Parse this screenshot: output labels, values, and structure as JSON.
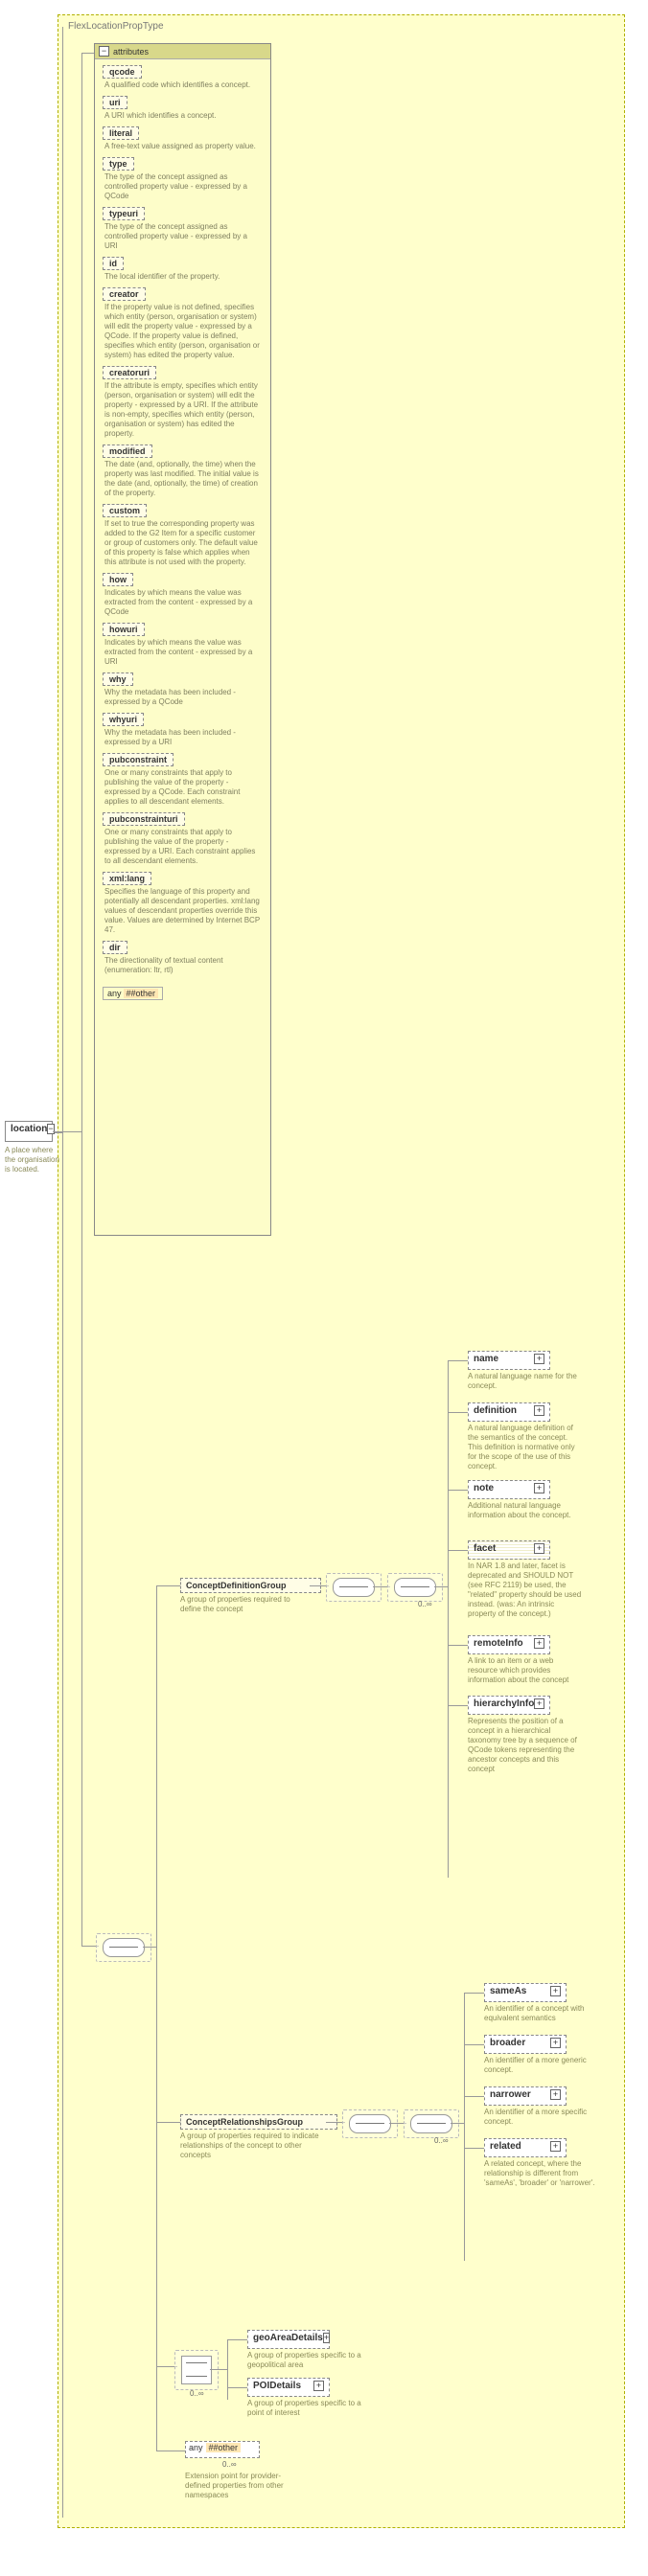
{
  "root": {
    "title": "FlexLocationPropType"
  },
  "attribs_header": "attributes",
  "attrs": [
    {
      "n": "qcode",
      "d": "A qualified code which identifies a concept."
    },
    {
      "n": "uri",
      "d": "A URI which identifies a concept."
    },
    {
      "n": "literal",
      "d": "A free-text value assigned as property value."
    },
    {
      "n": "type",
      "d": "The type of the concept assigned as controlled property value - expressed by a QCode"
    },
    {
      "n": "typeuri",
      "d": "The type of the concept assigned as controlled property value - expressed by a URI"
    },
    {
      "n": "id",
      "d": "The local identifier of the property."
    },
    {
      "n": "creator",
      "d": "If the property value is not defined, specifies which entity (person, organisation or system) will edit the property value - expressed by a QCode. If the property value is defined, specifies which entity (person, organisation or system) has edited the property value."
    },
    {
      "n": "creatoruri",
      "d": "If the attribute is empty, specifies which entity (person, organisation or system) will edit the property - expressed by a URI. If the attribute is non-empty, specifies which entity (person, organisation or system) has edited the property."
    },
    {
      "n": "modified",
      "d": "The date (and, optionally, the time) when the property was last modified. The initial value is the date (and, optionally, the time) of creation of the property."
    },
    {
      "n": "custom",
      "d": "If set to true the corresponding property was added to the G2 Item for a specific customer or group of customers only. The default value of this property is false which applies when this attribute is not used with the property."
    },
    {
      "n": "how",
      "d": "Indicates by which means the value was extracted from the content - expressed by a QCode"
    },
    {
      "n": "howuri",
      "d": "Indicates by which means the value was extracted from the content - expressed by a URI"
    },
    {
      "n": "why",
      "d": "Why the metadata has been included - expressed by a QCode"
    },
    {
      "n": "whyuri",
      "d": "Why the metadata has been included - expressed by a URI"
    },
    {
      "n": "pubconstraint",
      "d": "One or many constraints that apply to publishing the value of the property - expressed by a QCode. Each constraint applies to all descendant elements."
    },
    {
      "n": "pubconstrainturi",
      "d": "One or many constraints that apply to publishing the value of the property - expressed by a URI. Each constraint applies to all descendant elements."
    },
    {
      "n": "xml:lang",
      "d": "Specifies the language of this property and potentially all descendant properties. xml:lang values of descendant properties override this value. Values are determined by Internet BCP 47."
    },
    {
      "n": "dir",
      "d": "The directionality of textual content (enumeration: ltr, rtl)"
    }
  ],
  "any_other": "any ##other",
  "location": {
    "name": "location",
    "desc": "A place where the organisation is located."
  },
  "groups": {
    "cdg": {
      "name": "ConceptDefinitionGroup",
      "desc": "A group of properties required to define the concept"
    },
    "crg": {
      "name": "ConceptRelationshipsGroup",
      "desc": "A group of properties required to indicate relationships of the concept to other concepts"
    }
  },
  "cdg_children": [
    {
      "n": "name",
      "d": "A natural language name for the concept."
    },
    {
      "n": "definition",
      "d": "A natural language definition of the semantics of the concept. This definition is normative only for the scope of the use of this concept."
    },
    {
      "n": "note",
      "d": "Additional natural language information about the concept."
    },
    {
      "n": "facet",
      "d": "In NAR 1.8 and later, facet is deprecated and SHOULD NOT (see RFC 2119) be used, the \"related\" property should be used instead. (was: An intrinsic property of the concept.)"
    },
    {
      "n": "remoteInfo",
      "d": "A link to an item or a web resource which provides information about the concept"
    },
    {
      "n": "hierarchyInfo",
      "d": "Represents the position of a concept in a hierarchical taxonomy tree by a sequence of QCode tokens representing the ancestor concepts and this concept"
    }
  ],
  "crg_children": [
    {
      "n": "sameAs",
      "d": "An identifier of a concept with equivalent semantics"
    },
    {
      "n": "broader",
      "d": "An identifier of a more generic concept."
    },
    {
      "n": "narrower",
      "d": "An identifier of a more specific concept."
    },
    {
      "n": "related",
      "d": "A related concept, where the relationship is different from 'sameAs', 'broader' or 'narrower'."
    }
  ],
  "choice_children": [
    {
      "n": "geoAreaDetails",
      "d": "A group of properties specific to a geopolitical area"
    },
    {
      "n": "POIDetails",
      "d": "A group of properties specific to a point of interest"
    }
  ],
  "bottom_any": {
    "label": "any ##other",
    "card": "0..∞",
    "desc": "Extension point for provider-defined properties from other namespaces"
  },
  "card_inf": "0..∞"
}
